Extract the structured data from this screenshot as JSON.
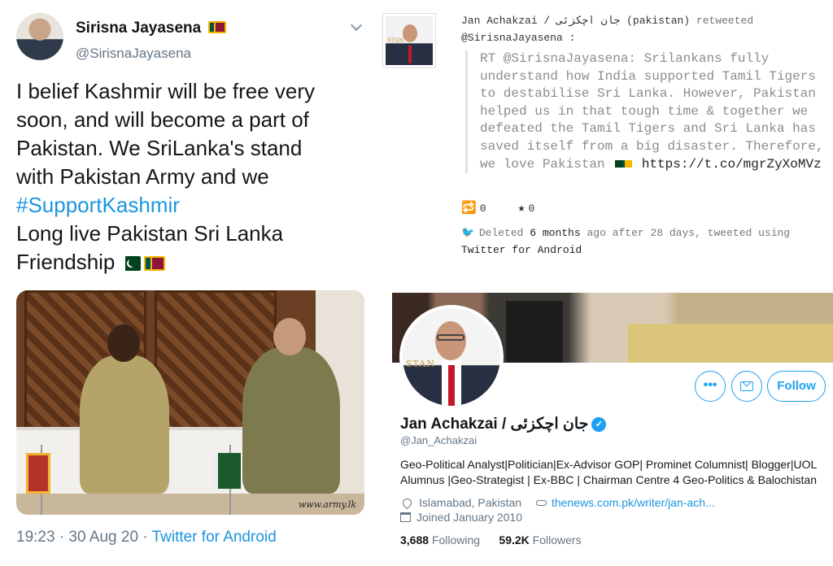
{
  "left_tweet": {
    "author_name": "Sirisna Jayasena",
    "author_handle": "@SirisnaJayasena",
    "text_lines": [
      "I belief Kashmir will be free very",
      "soon, and will become a part of",
      "Pakistan. We SriLanka's stand",
      "with Pakistan Army and we"
    ],
    "hashtag": "#SupportKashmir",
    "text_lines_2": [
      "Long live Pakistan Sri Lanka",
      "Friendship"
    ],
    "image_watermark": "www.army.lk",
    "timestamp": "19:23 · 30 Aug 20 · ",
    "source": "Twitter for Android"
  },
  "archive": {
    "retweeter": "Jan Achakzai / جان اچکزئی",
    "retweeter_handle_label": "(pakistan)",
    "retweeted_label": "retweeted",
    "original_handle": "@SirisnaJayasena :",
    "avatar_text": "STAN",
    "body_lines": [
      "RT @SirisnaJayasena: Srilankans fully",
      "understand how India supported Tamil Tigers",
      "to destabilise Sri Lanka. However, Pakistan",
      "helped us in that tough time & together we",
      "defeated the Tamil Tigers and Sri Lanka has",
      "saved itself from a big disaster. Therefore,"
    ],
    "body_last_prefix": "we love Pakistan",
    "body_link": "https://t.co/mgrZyXoMVz",
    "retweet_count": "0",
    "like_count": "0",
    "deleted_prefix": "Deleted",
    "deleted_age": "6 months",
    "deleted_mid": "ago after 28 days, tweeted using",
    "deleted_client": "Twitter for Android"
  },
  "profile": {
    "name": "Jan Achakzai / جان اچکزئی",
    "handle": "@Jan_Achakzai",
    "avatar_text": "STAN",
    "bio_lines": [
      "Geo-Political Analyst|Politician|Ex-Advisor GOP| Prominet Columnist| Blogger|UOL",
      "Alumnus |Geo-Strategist | Ex-BBC | Chairman Centre 4 Geo-Politics & Balochistan"
    ],
    "location": "Islamabad, Pakistan",
    "website": "thenews.com.pk/writer/jan-ach...",
    "joined": "Joined January 2010",
    "following_count": "3,688",
    "following_label": "Following",
    "followers_count": "59.2K",
    "followers_label": "Followers",
    "more_label": "•••",
    "follow_label": "Follow",
    "verified_mark": "✓"
  },
  "icons": {
    "retweet": "🔁",
    "star": "★",
    "bird": "🐦"
  },
  "colors": {
    "twitter_blue": "#1da1f2",
    "link_blue": "#1b95e0",
    "muted_gray": "#657786"
  }
}
